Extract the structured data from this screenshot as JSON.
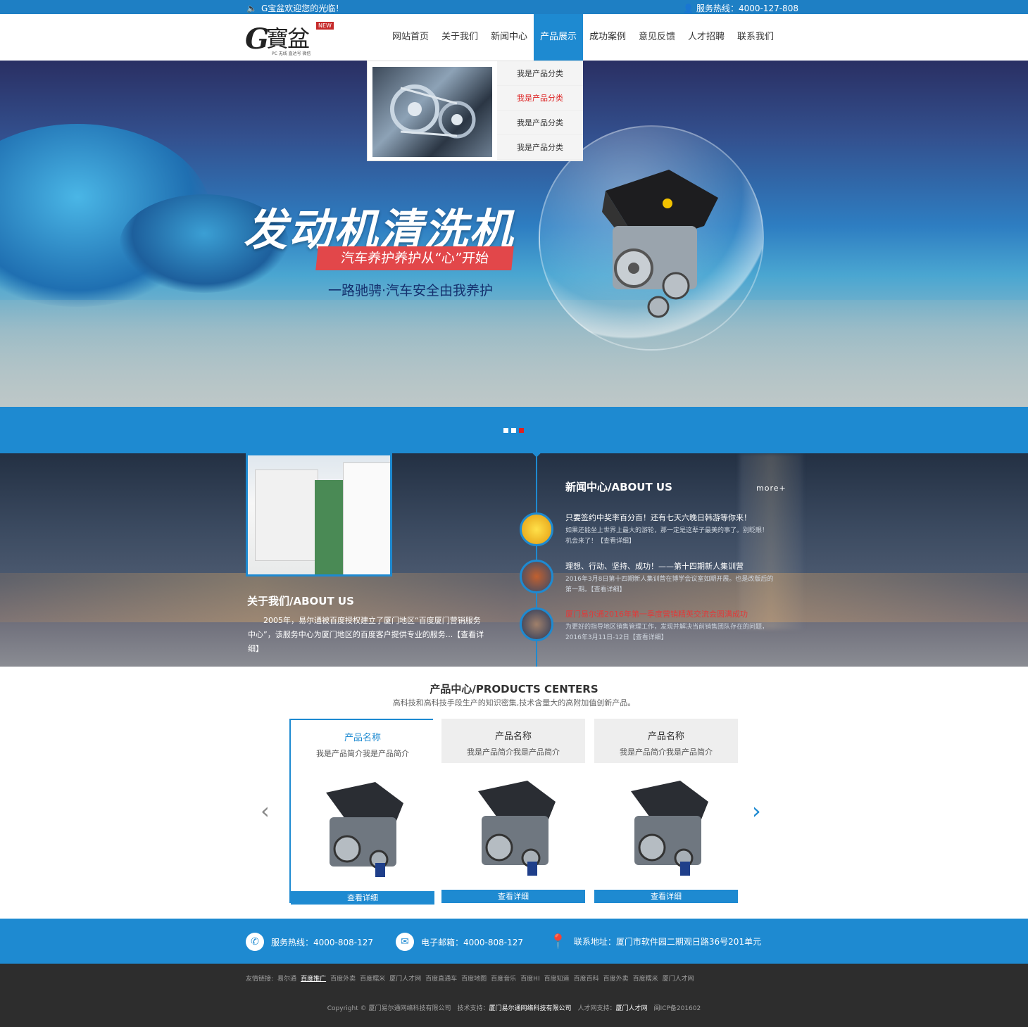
{
  "topbar": {
    "welcome": "G宝盆欢迎您的光临！",
    "hotline": "服务热线：4000-127-808"
  },
  "logo": {
    "mark": "G",
    "name": "寶盆",
    "badge": "NEW",
    "sub": "PC 无线 直达号 微信"
  },
  "nav": [
    "网站首页",
    "关于我们",
    "新闻中心",
    "产品展示",
    "成功案例",
    "意见反馈",
    "人才招聘",
    "联系我们"
  ],
  "dropdown": [
    "我是产品分类",
    "我是产品分类",
    "我是产品分类",
    "我是产品分类"
  ],
  "banner": {
    "title": "发动机清洗机",
    "ribbon": "汽车养护养护从“心”开始",
    "slogan": "一路驰骋·汽车安全由我养护"
  },
  "about": {
    "title": "关于我们/ABOUT US",
    "text": "2005年，易尔通被百度授权建立了厦门地区“百度厦门营销服务中心”，该服务中心为厦门地区的百度客户提供专业的服务...【查看详细】"
  },
  "news": {
    "title": "新闻中心/ABOUT US",
    "more": "more+",
    "items": [
      {
        "title": "只要签约中奖率百分百！还有七天六晚日韩游等你来！",
        "desc": "如果还能坐上世界上最大的游轮，那一定是这辈子最美的事了。别眨眼！机会来了！【查看详细】"
      },
      {
        "title": "理想、行动、坚持、成功！——第十四期新人集训营",
        "desc": "2016年3月8日第十四期新人集训营在博学会议室如期开展。也是改版后的第一期。【查看详细】"
      },
      {
        "title": "厦门易尔通2016年第一季度营销精英交流会圆满成功",
        "desc": "为更好的指导地区销售管理工作，发现并解决当前销售团队存在的问题，2016年3月11日-12日【查看详细】"
      }
    ]
  },
  "products": {
    "title": "产品中心/PRODUCTS CENTERS",
    "subtitle": "高科技和高科技手段生产的知识密集,技术含量大的高附加值创新产品。",
    "items": [
      {
        "name": "产品名称",
        "desc": "我是产品简介我是产品简介",
        "button": "查看详细"
      },
      {
        "name": "产品名称",
        "desc": "我是产品简介我是产品简介",
        "button": "查看详细"
      },
      {
        "name": "产品名称",
        "desc": "我是产品简介我是产品简介",
        "button": "查看详细"
      }
    ]
  },
  "contact": {
    "phone": "服务热线：4000-808-127",
    "email": "电子邮箱：4000-808-127",
    "address": "联系地址：厦门市软件园二期观日路36号201单元"
  },
  "footer": {
    "links_label": "友情链接:",
    "links": [
      "易尔通",
      "百度推广",
      "百度外卖",
      "百度糯米",
      "厦门人才网",
      "百度直通车",
      "百度地图",
      "百度音乐",
      "百度HI",
      "百度知道",
      "百度百科",
      "百度外卖",
      "百度糯米",
      "厦门人才网"
    ],
    "copy_prefix": "Copyright © 厦门易尔通网络科技有限公司　技术支持：",
    "copy_company": "厦门易尔通网络科技有限公司",
    "copy_mid": "　人才网支持：",
    "copy_talent": "厦门人才网",
    "copy_icp": "　闽ICP备201602"
  },
  "colors": {
    "primary": "#1e8ad1",
    "accent_red": "#e2474a",
    "footer_bg": "#2d2d2d"
  }
}
